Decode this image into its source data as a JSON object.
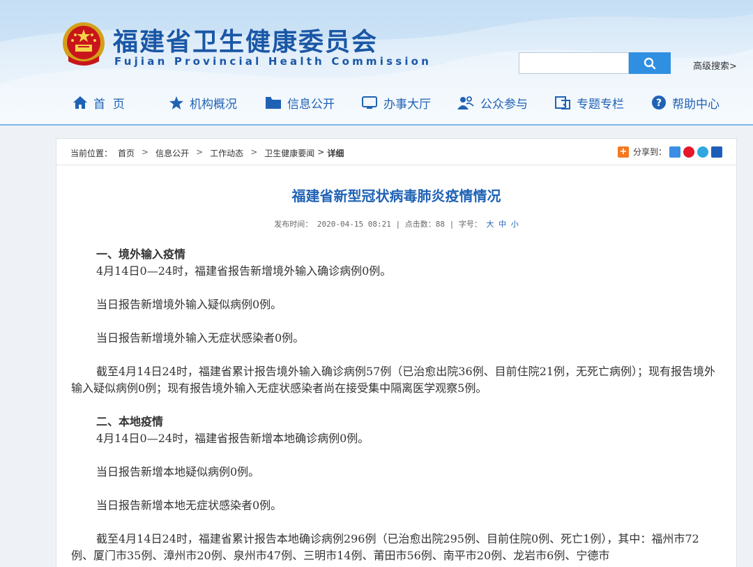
{
  "header": {
    "title_cn": "福建省卫生健康委员会",
    "title_en": "Fujian Provincial Health Commission",
    "search_placeholder": "",
    "adv_search": "高级搜索>"
  },
  "nav": {
    "items": [
      {
        "label": "首  页",
        "icon": "home-icon"
      },
      {
        "label": "机构概况",
        "icon": "star-icon"
      },
      {
        "label": "信息公开",
        "icon": "folder-icon"
      },
      {
        "label": "办事大厅",
        "icon": "monitor-icon"
      },
      {
        "label": "公众参与",
        "icon": "people-icon"
      },
      {
        "label": "专题专栏",
        "icon": "topic-icon"
      },
      {
        "label": "帮助中心",
        "icon": "help-icon"
      }
    ]
  },
  "breadcrumb": {
    "prefix": "当前位置：",
    "items": [
      "首页",
      "信息公开",
      "工作动态",
      "卫生健康要闻"
    ],
    "current": "详细"
  },
  "share": {
    "label": "分享到："
  },
  "article": {
    "title": "福建省新型冠状病毒肺炎疫情情况",
    "meta_prefix": "发布时间： 2020-04-15 08:21 | 点击数：88 | 字号：",
    "size_large": "大",
    "size_medium": "中",
    "size_small": "小",
    "s1_heading": "一、境外输入疫情",
    "s1_p1": "4月14日0—24时，福建省报告新增境外输入确诊病例0例。",
    "s1_p2": "当日报告新增境外输入疑似病例0例。",
    "s1_p3": "当日报告新增境外输入无症状感染者0例。",
    "s1_p4": "截至4月14日24时，福建省累计报告境外输入确诊病例57例（已治愈出院36例、目前住院21例，无死亡病例）；现有报告境外输入疑似病例0例；现有报告境外输入无症状感染者尚在接受集中隔离医学观察5例。",
    "s2_heading": "二、本地疫情",
    "s2_p1": "4月14日0—24时，福建省报告新增本地确诊病例0例。",
    "s2_p2": "当日报告新增本地疑似病例0例。",
    "s2_p3": "当日报告新增本地无症状感染者0例。",
    "s2_p4": "截至4月14日24时，福建省累计报告本地确诊病例296例（已治愈出院295例、目前住院0例、死亡1例），其中：福州市72例、厦门市35例、漳州市20例、泉州市47例、三明市14例、莆田市56例、南平市20例、龙岩市6例、宁德市"
  },
  "colors": {
    "brand_blue": "#1a57a6",
    "link_blue": "#1f62b5",
    "search_blue": "#2f8fe0"
  }
}
